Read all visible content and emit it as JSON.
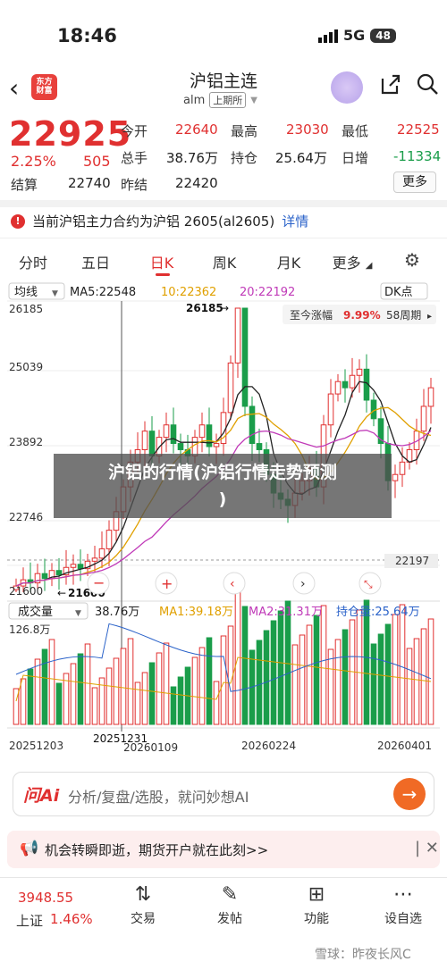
{
  "status": {
    "time": "18:46",
    "network": "5G",
    "battery": "48"
  },
  "header": {
    "title": "沪铝主连",
    "code": "alm",
    "period_tag": "上期所",
    "logo_text": "东方财富"
  },
  "quote": {
    "price": "22925",
    "pct": "2.25%",
    "change": "505",
    "open_lbl": "今开",
    "open": "22640",
    "high_lbl": "最高",
    "high": "23030",
    "low_lbl": "最低",
    "low": "22525",
    "vol_lbl": "总手",
    "vol": "38.76万",
    "oi_lbl": "持仓",
    "oi": "25.64万",
    "dinc_lbl": "日增",
    "dinc": "-11334",
    "settle_lbl": "结算",
    "settle": "22740",
    "prev_lbl": "昨结",
    "prev": "22420",
    "more": "更多"
  },
  "notice": {
    "text": "当前沪铝主力合约为沪铝 2605(al2605)",
    "link": "详情"
  },
  "tabs": [
    "分时",
    "五日",
    "日K",
    "周K",
    "月K",
    "更多"
  ],
  "chart": {
    "ma_selector": "均线",
    "ma5": "MA5:22548",
    "ma10": "10:22362",
    "ma20": "20:22192",
    "dk": "DK点",
    "range_label": "至今涨幅",
    "range_pct": "9.99%",
    "range_period": "58周期",
    "y_ticks": [
      "26185",
      "25039",
      "23892",
      "22746",
      "21600"
    ],
    "high_marker": "26185",
    "low_marker": "21600",
    "current_marker": "22197",
    "vol_selector": "成交量",
    "vol_value": "38.76万",
    "vol_ma1": "MA1:39.18万",
    "vol_ma2": "MA2:31.31万",
    "vol_oi": "持仓量:25.64万",
    "vol_max": "126.8万",
    "dates": [
      "20251203",
      "20251231",
      "20260109",
      "20260224",
      "20260401"
    ]
  },
  "overlay": {
    "line1": "沪铝的行情(沪铝行情走势预测",
    "line2": ")"
  },
  "ai": {
    "logo": "问Ai",
    "text": "分析/复盘/选股，就问妙想AI"
  },
  "promo": {
    "text": "机会转瞬即逝，期货开户就在此刻>>"
  },
  "bottom": {
    "index_value": "3948.55",
    "index_name": "上证",
    "index_pct": "1.46%",
    "trade": "交易",
    "post": "发帖",
    "func": "功能",
    "watch": "设自选"
  },
  "watermark": "雪球：昨夜长风C",
  "colors": {
    "up": "#e03030",
    "down": "#1a9d4a",
    "accent": "#e03030"
  }
}
